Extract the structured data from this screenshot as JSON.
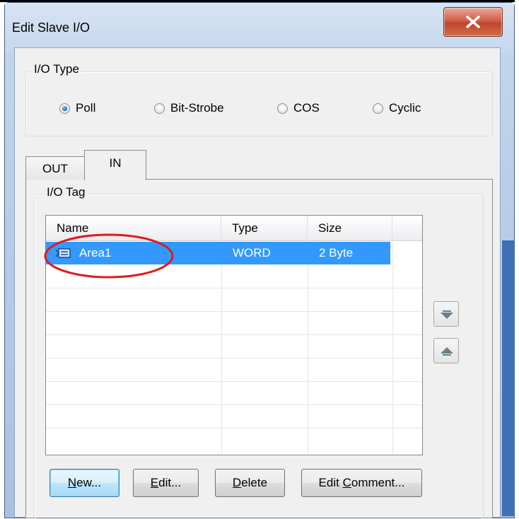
{
  "window": {
    "title": "Edit Slave I/O",
    "close_label": "Close"
  },
  "io_type": {
    "group_label": "I/O Type",
    "options": [
      {
        "label": "Poll",
        "checked": true
      },
      {
        "label": "Bit-Strobe",
        "checked": false
      },
      {
        "label": "COS",
        "checked": false
      },
      {
        "label": "Cyclic",
        "checked": false
      }
    ]
  },
  "tabs": [
    {
      "label": "OUT",
      "active": false
    },
    {
      "label": "IN",
      "active": true
    }
  ],
  "io_tag": {
    "group_label": "I/O Tag",
    "columns": [
      "Name",
      "Type",
      "Size"
    ],
    "rows": [
      {
        "name": "Area1",
        "type": "WORD",
        "size": "2 Byte",
        "selected": true,
        "icon": "io-tag-icon"
      }
    ]
  },
  "side_buttons": {
    "down_icon": "move-down-icon",
    "up_icon": "move-up-icon"
  },
  "buttons": {
    "new": {
      "pre": "",
      "accel": "N",
      "post": "ew..."
    },
    "edit": {
      "pre": "",
      "accel": "E",
      "post": "dit..."
    },
    "delete": {
      "pre": "",
      "accel": "D",
      "post": "elete"
    },
    "edit_comment": {
      "pre": "Edit ",
      "accel": "C",
      "post": "omment..."
    }
  },
  "annotation": {
    "color": "#e01b1b",
    "shape": "ellipse"
  },
  "colors": {
    "selection": "#3399ff",
    "close_button": "#c1452c"
  }
}
